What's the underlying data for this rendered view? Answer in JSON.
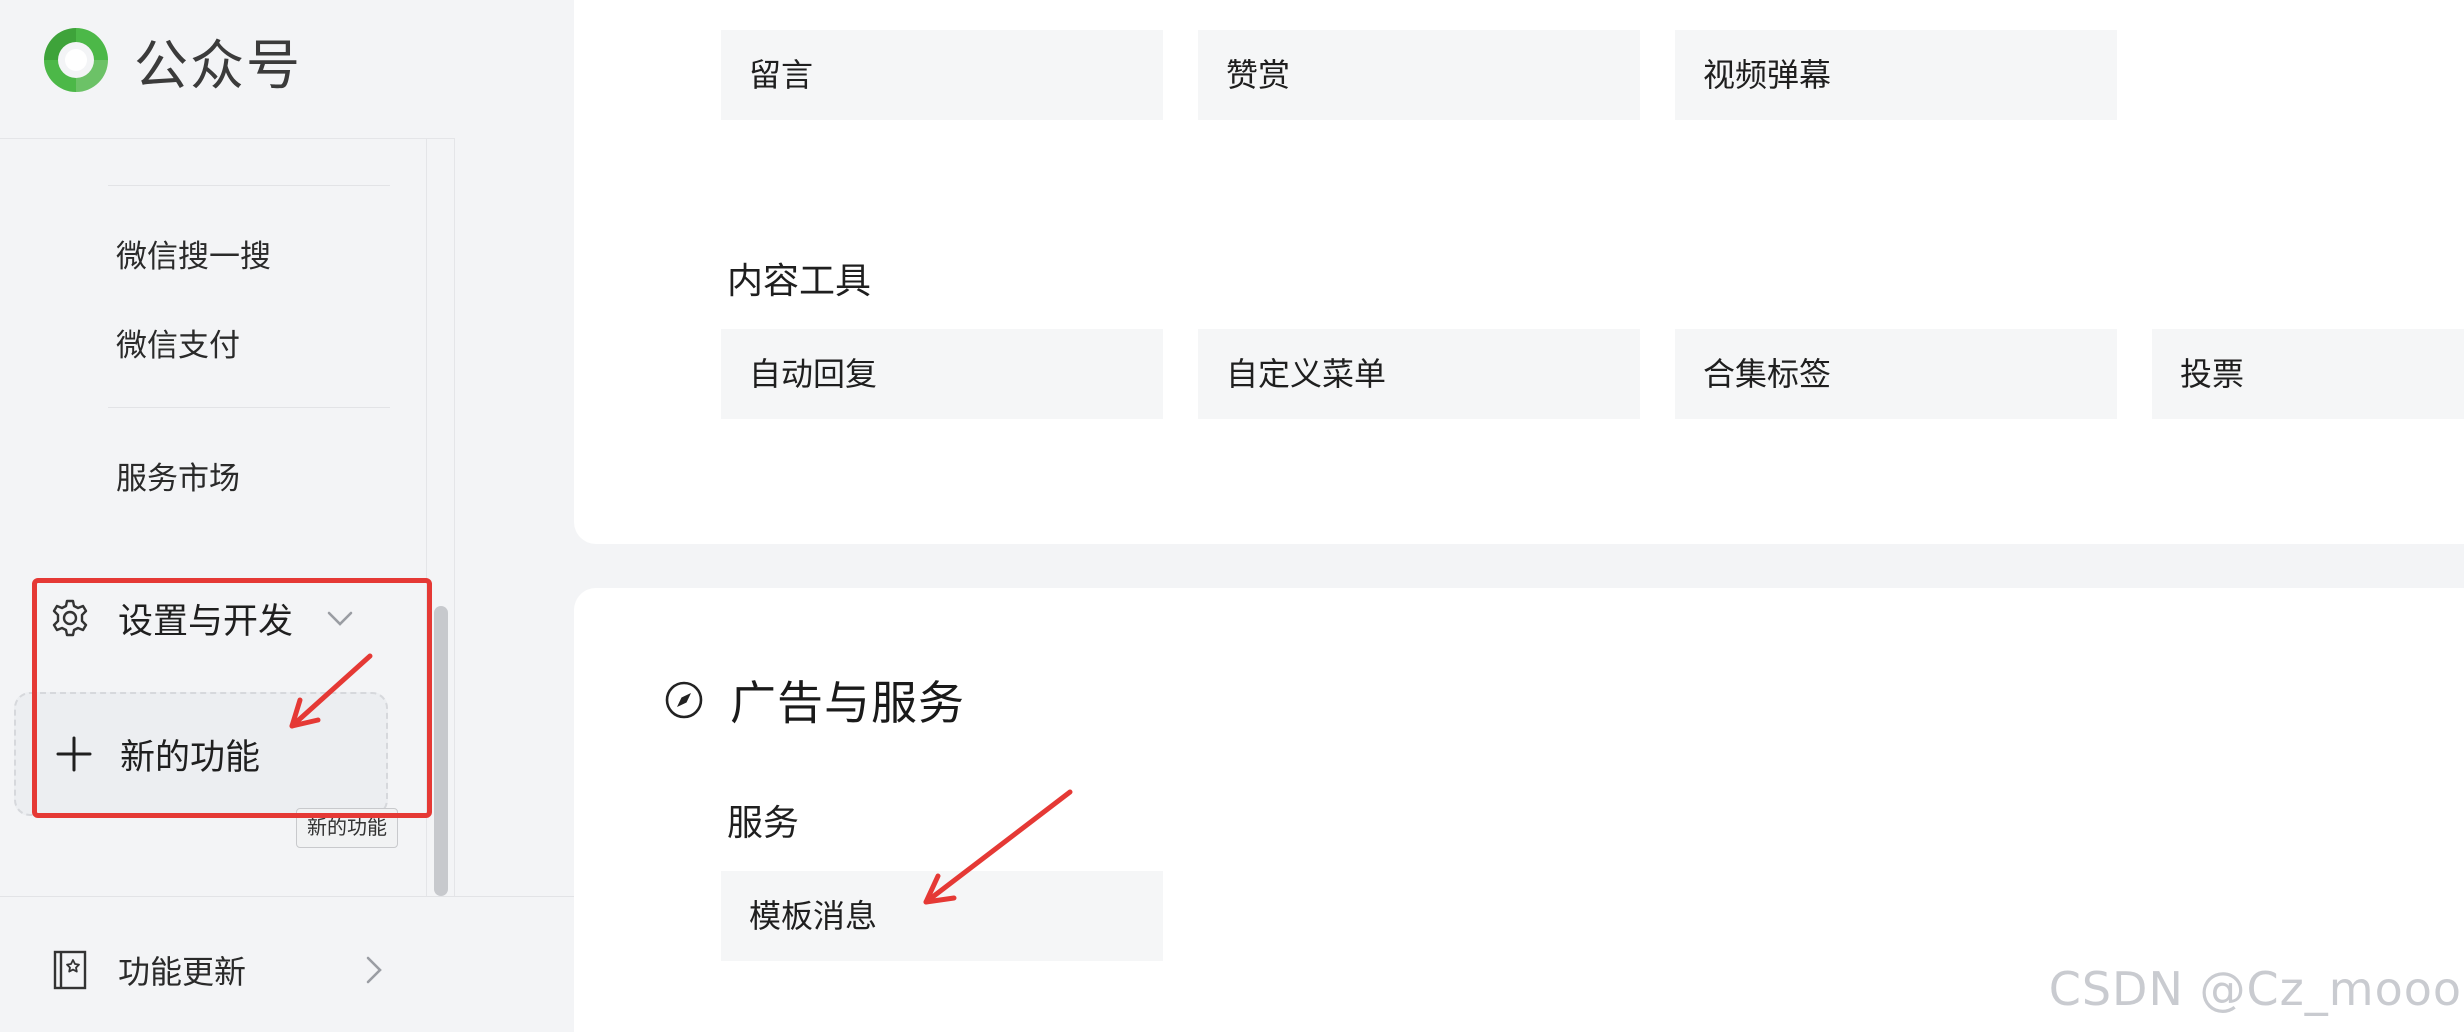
{
  "brand": {
    "name": "公众号"
  },
  "sidebar": {
    "links": [
      {
        "label": "微信搜一搜"
      },
      {
        "label": "微信支付"
      },
      {
        "label": "服务市场"
      }
    ],
    "settings_label": "设置与开发",
    "new_feature_label": "新的功能",
    "new_feature_tooltip": "新的功能",
    "updates_label": "功能更新"
  },
  "main": {
    "interaction_tiles": [
      "留言",
      "赞赏",
      "视频弹幕"
    ],
    "content_tools": {
      "title": "内容工具",
      "tiles": [
        "自动回复",
        "自定义菜单",
        "合集标签",
        "投票"
      ]
    },
    "ads_section": {
      "title": "广告与服务",
      "services_title": "服务",
      "tiles": [
        "模板消息"
      ]
    }
  },
  "watermark": "CSDN @Cz_mooo",
  "colors": {
    "annotation_red": "#e53935",
    "brand_green": "#4cb848",
    "tile_bg": "#f5f6f7",
    "page_bg": "#f3f4f6"
  },
  "icons": {
    "brand": "wechat-official-account-logo",
    "settings": "gear-icon",
    "settings_expand": "chevron-down-icon",
    "new_feature": "plus-icon",
    "updates": "book-star-icon",
    "updates_open": "chevron-right-icon",
    "ads_section": "compass-icon"
  }
}
